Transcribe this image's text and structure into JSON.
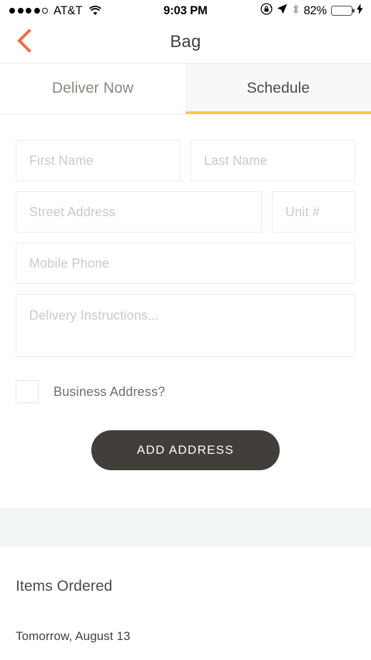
{
  "status_bar": {
    "signal_filled": 4,
    "signal_total": 5,
    "carrier": "AT&T",
    "wifi_icon": "wifi-icon",
    "time": "9:03 PM",
    "rotation_lock_icon": "rotation-lock-icon",
    "location_icon": "location-arrow-icon",
    "bluetooth_icon": "bluetooth-icon",
    "battery_percent": "82%",
    "battery_level": 82,
    "charging_icon": "lightning-bolt-icon",
    "battery_color": "#33cc4a"
  },
  "nav": {
    "back_icon": "chevron-left-icon",
    "back_icon_color": "#e8714a",
    "title": "Bag"
  },
  "tabs": {
    "active_index": 1,
    "accent_color": "#fbc840",
    "items": [
      {
        "label": "Deliver Now",
        "active": false
      },
      {
        "label": "Schedule",
        "active": true
      }
    ]
  },
  "form": {
    "first_name": {
      "placeholder": "First Name",
      "value": ""
    },
    "last_name": {
      "placeholder": "Last Name",
      "value": ""
    },
    "street_address": {
      "placeholder": "Street Address",
      "value": ""
    },
    "unit": {
      "placeholder": "Unit #",
      "value": ""
    },
    "mobile_phone": {
      "placeholder": "Mobile Phone",
      "value": ""
    },
    "delivery_instructions": {
      "placeholder": "Delivery Instructions...",
      "value": ""
    },
    "business_address": {
      "label": "Business Address?",
      "checked": false
    },
    "submit": {
      "label": "ADD ADDRESS",
      "background": "#423f3b"
    }
  },
  "items_section": {
    "title": "Items Ordered",
    "date": "Tomorrow, August 13"
  }
}
